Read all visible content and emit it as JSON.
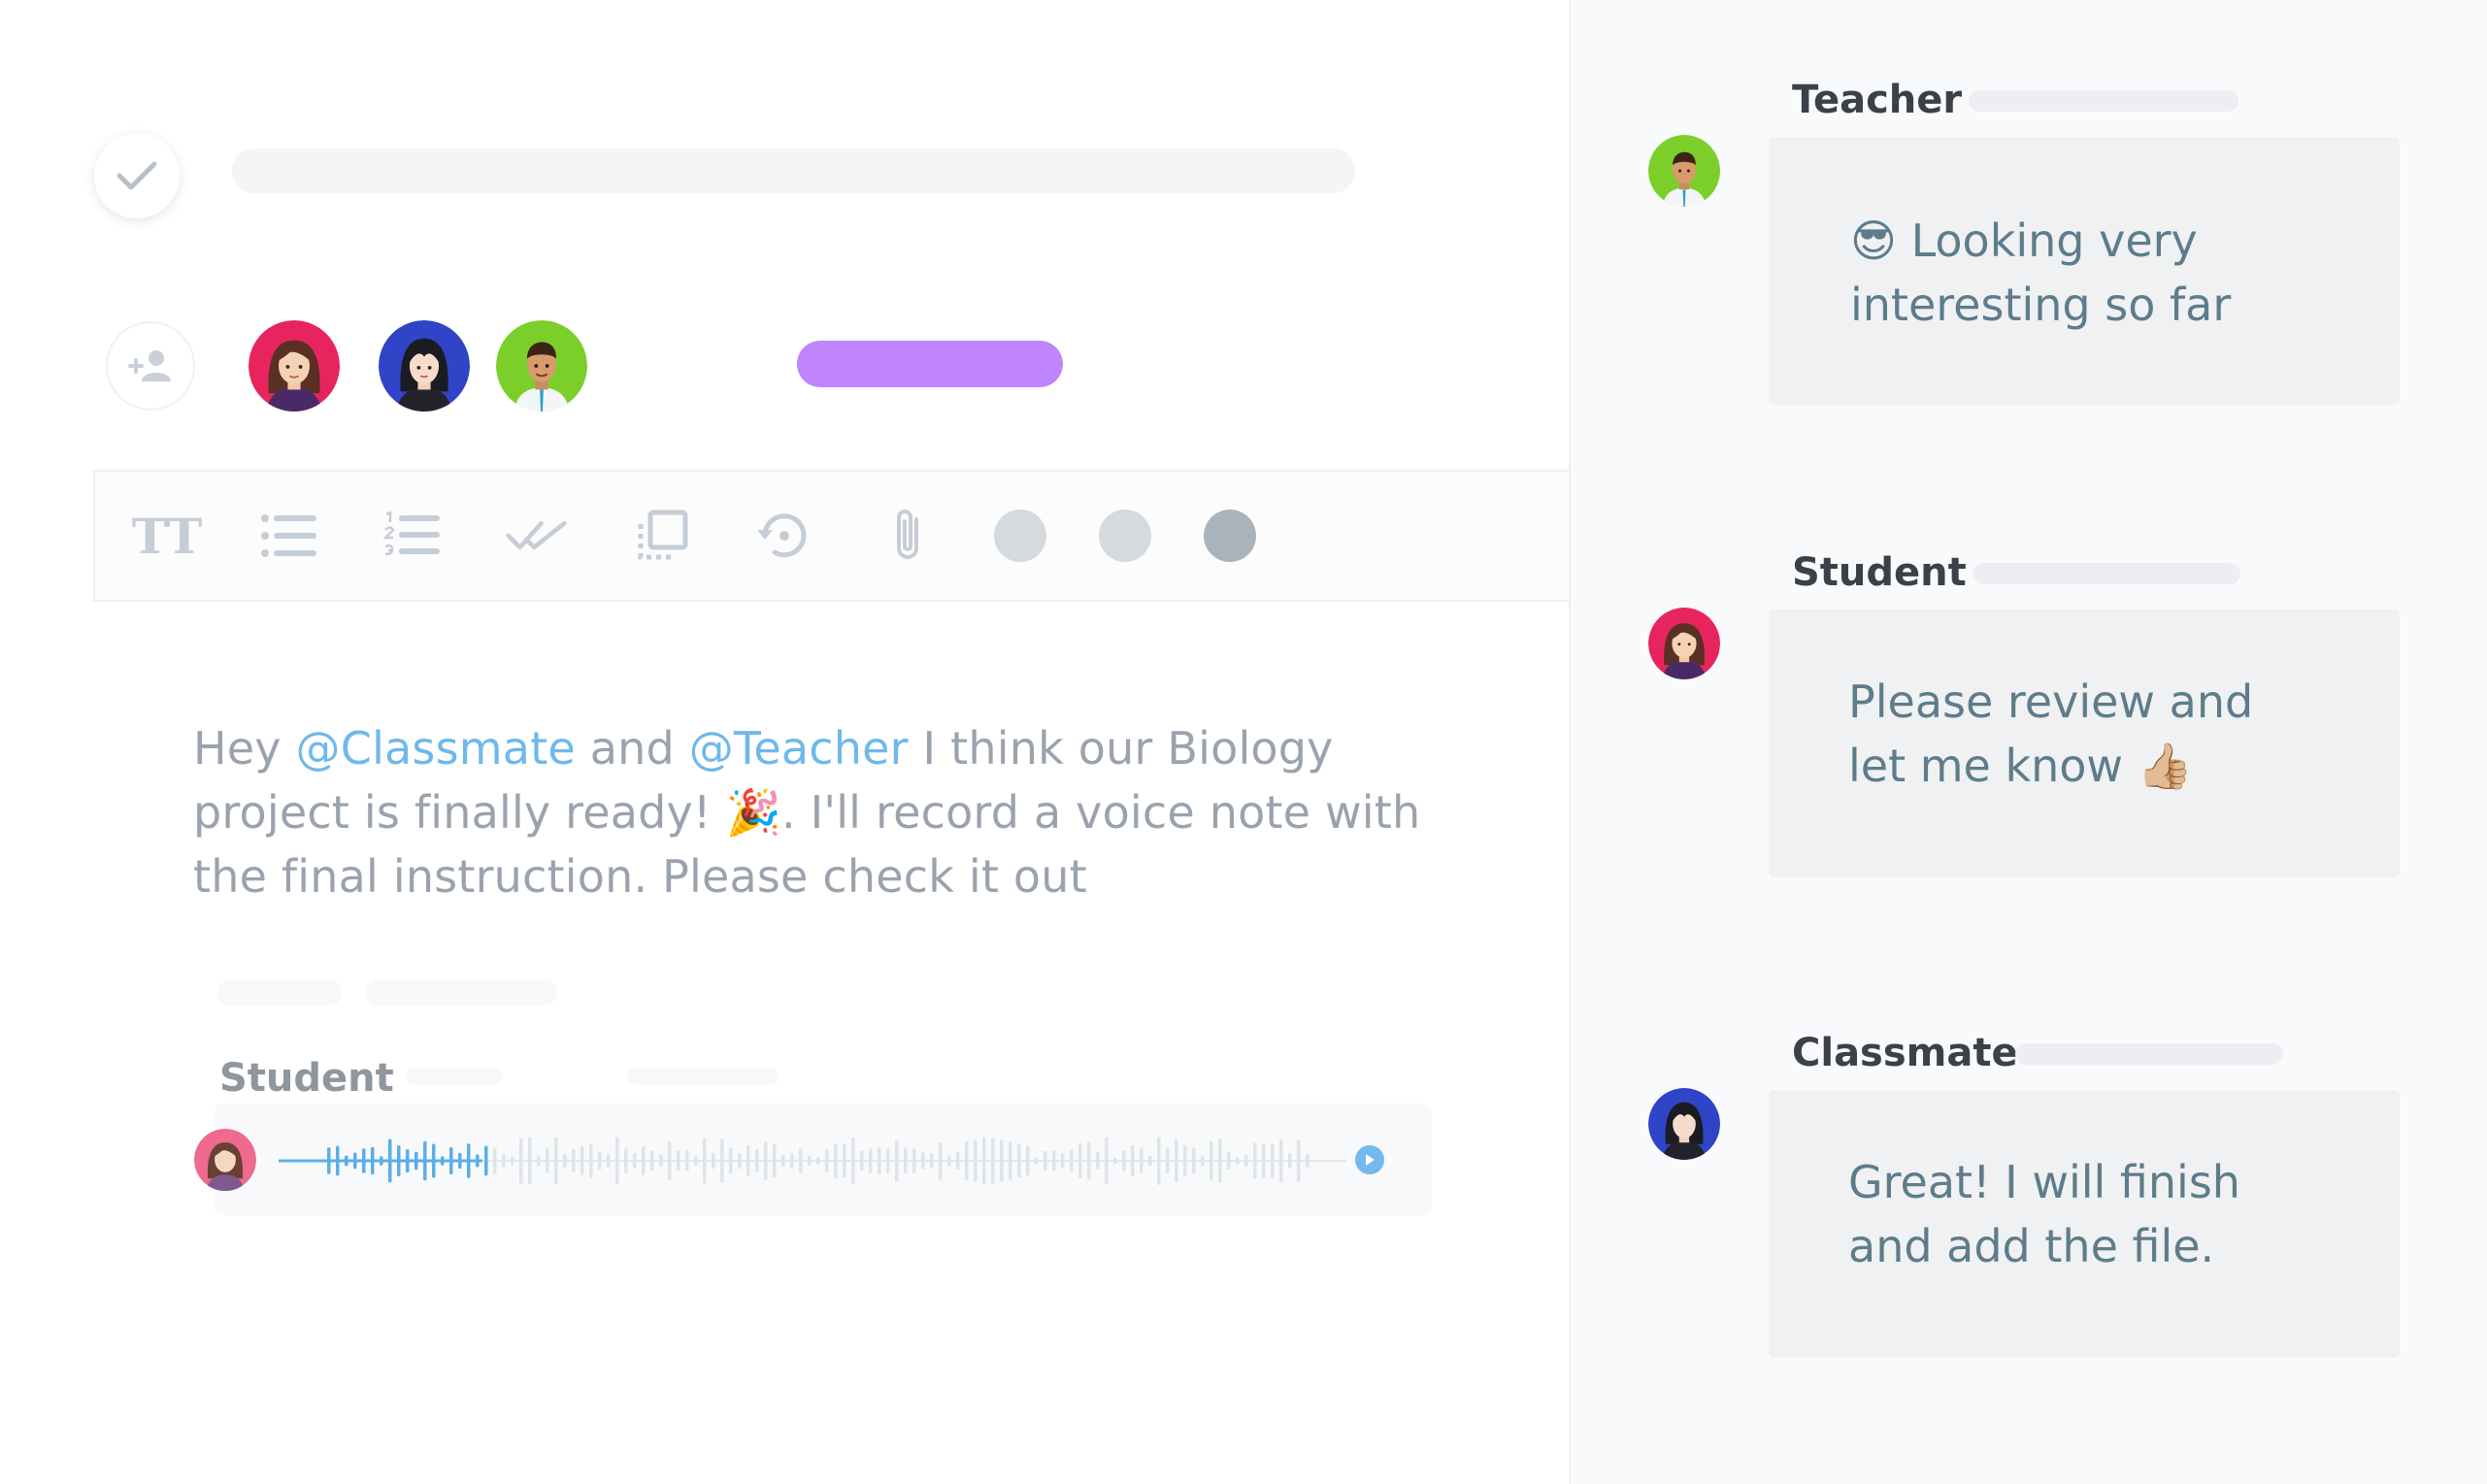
{
  "editor": {
    "message": {
      "part1": "Hey ",
      "mention1": "@Classmate",
      "part2": " and ",
      "mention2": "@Teacher",
      "part3": " I think our Biology project is finally ready! ",
      "emoji": "🎉",
      "part4": ". I'll record a voice note with the final instruction. Please check it out"
    },
    "toolbar": {
      "text_format_glyph": "TT",
      "color_dots": [
        "#d5dade",
        "#d5dade",
        "#a9b3bc"
      ]
    },
    "voice_note": {
      "author": "Student",
      "accent_color": "#5aaee8"
    },
    "purple_pill_color": "#c084fc"
  },
  "comments": [
    {
      "author": "Teacher",
      "emoji": "😎",
      "text": "Looking very interesting so far"
    },
    {
      "author": "Student",
      "text": "Please review and let me know",
      "emoji": "👍🏼"
    },
    {
      "author": "Classmate",
      "text": "Great! I will finish and add the file."
    }
  ]
}
